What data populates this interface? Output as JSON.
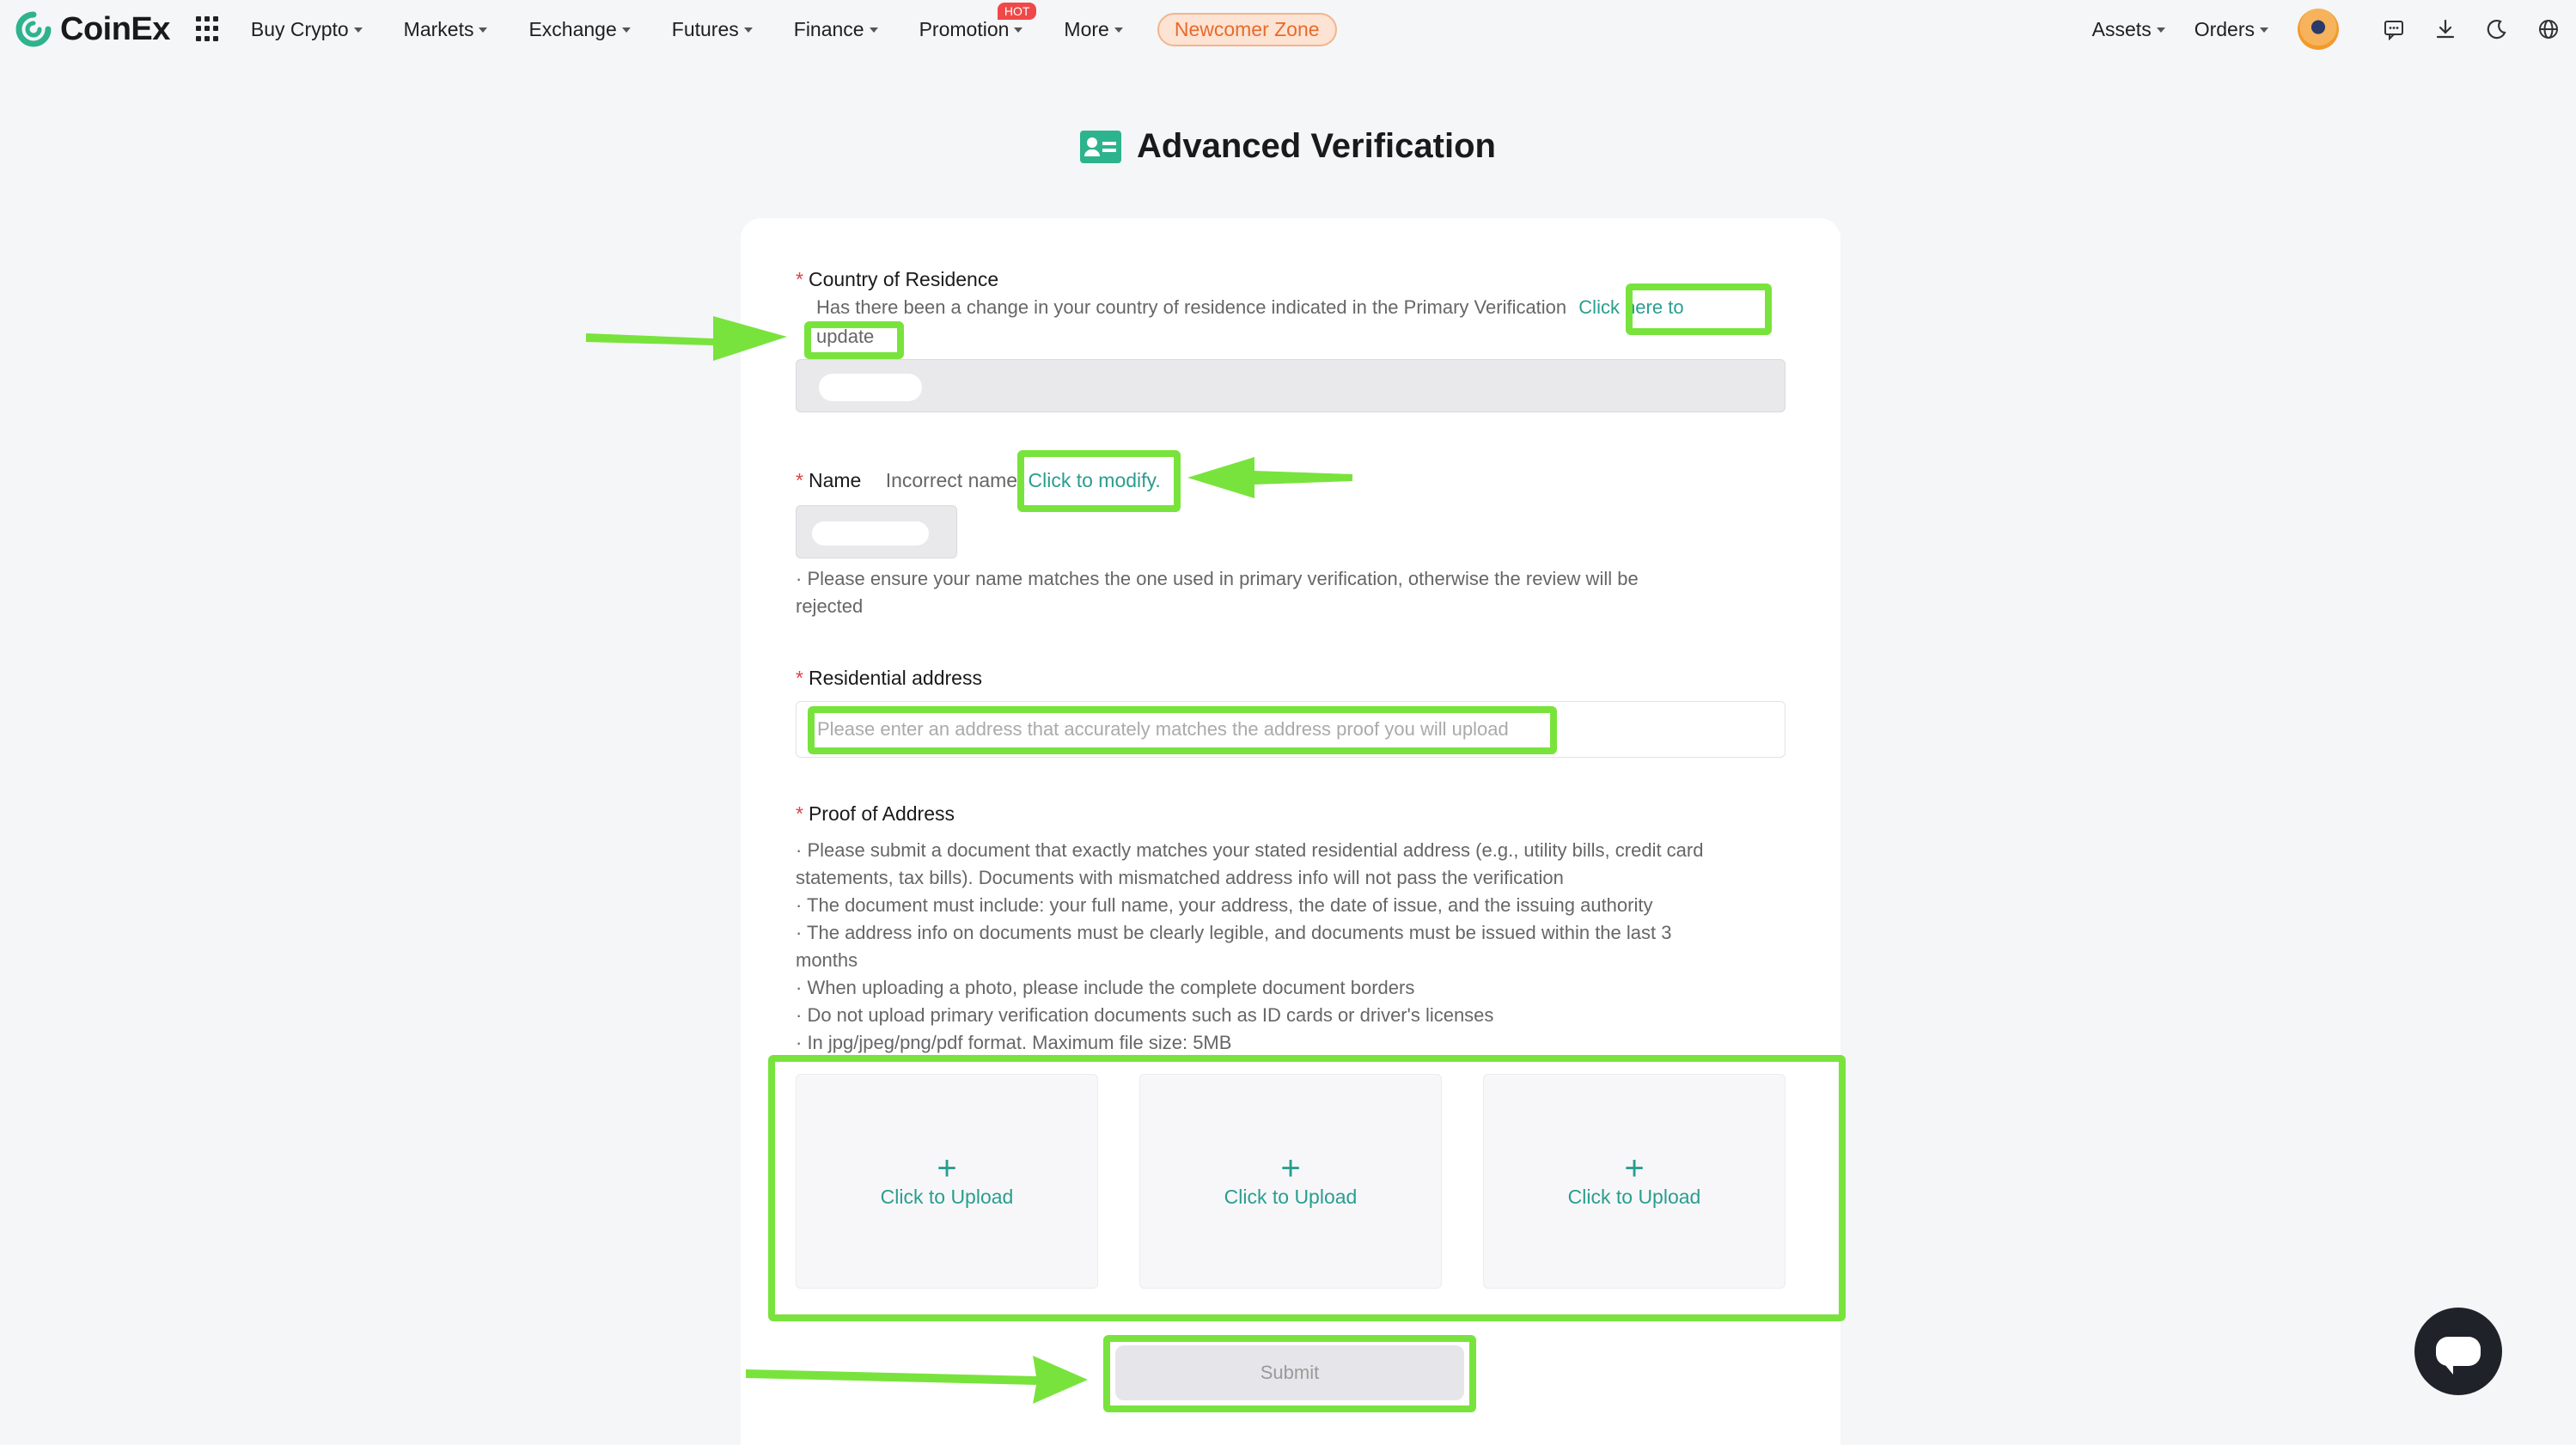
{
  "brand": {
    "name": "CoinEx"
  },
  "nav": {
    "items": [
      {
        "label": "Buy Crypto"
      },
      {
        "label": "Markets"
      },
      {
        "label": "Exchange"
      },
      {
        "label": "Futures"
      },
      {
        "label": "Finance"
      },
      {
        "label": "Promotion",
        "badge": "HOT"
      },
      {
        "label": "More"
      }
    ],
    "newcomer": "Newcomer Zone",
    "assets": "Assets",
    "orders": "Orders"
  },
  "page": {
    "title": "Advanced Verification"
  },
  "form": {
    "country": {
      "label": "Country of Residence",
      "hint": "Has there been a change in your country of residence indicated in the Primary Verification",
      "link_part1": "Click here to",
      "link_part2": "update"
    },
    "name": {
      "label": "Name",
      "hint": "Incorrect name",
      "link": "Click to modify.",
      "note_line1": "·  Please ensure your name matches the one used in primary verification, otherwise the review will be",
      "note_line2": "rejected"
    },
    "address": {
      "label": "Residential address",
      "placeholder": "Please enter an address that accurately matches the address proof you will upload"
    },
    "proof": {
      "label": "Proof of Address",
      "lines": [
        "·  Please submit a document that exactly matches your stated residential address (e.g., utility bills, credit card",
        "statements, tax bills). Documents with mismatched address info will not pass the verification",
        "·  The document must include: your full name, your address, the date of issue, and the issuing authority",
        "·  The address info on documents must be clearly legible, and documents must be issued within the last 3",
        "months",
        "·  When uploading a photo, please include the complete document borders",
        "·  Do not upload primary verification documents such as ID cards or driver's licenses",
        "·  In jpg/jpeg/png/pdf format. Maximum file size: 5MB"
      ],
      "upload_label": "Click to Upload"
    },
    "submit": "Submit"
  },
  "colors": {
    "accent": "#2a9d8f",
    "highlight": "#79e33d",
    "required": "#e04141"
  }
}
